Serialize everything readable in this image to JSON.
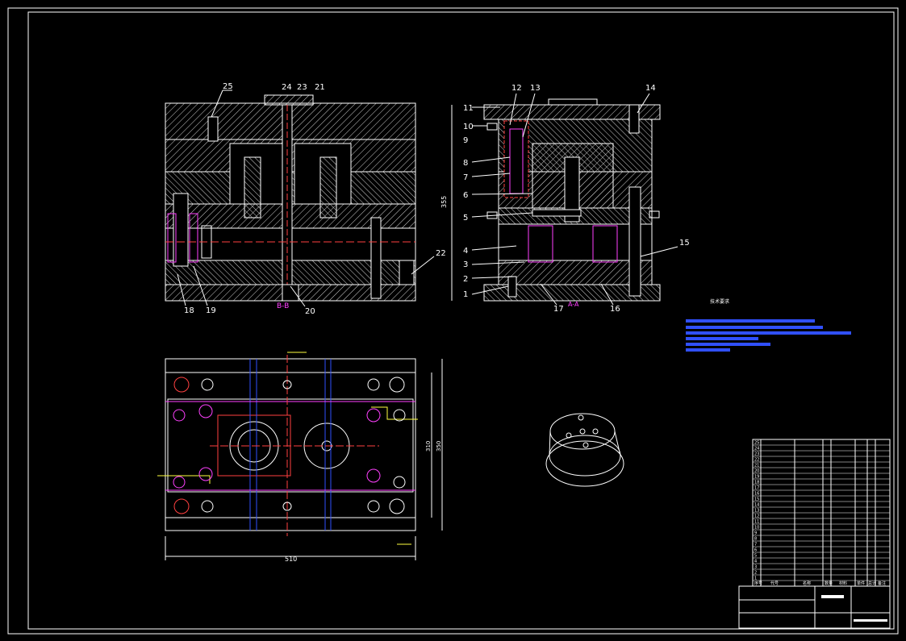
{
  "sheet": {
    "background": "#000000",
    "line_color": "#ffffff",
    "accent_red": "#ff3030",
    "accent_magenta": "#ff40ff",
    "accent_yellow": "#ffff40",
    "accent_blue": "#3050ff"
  },
  "section_left": {
    "caption": "B-B",
    "callouts": [
      "18",
      "19",
      "20",
      "21",
      "22",
      "23",
      "24",
      "25"
    ]
  },
  "section_right": {
    "caption": "A-A",
    "height_dim": "355",
    "callouts": [
      "1",
      "2",
      "3",
      "4",
      "5",
      "6",
      "7",
      "8",
      "9",
      "10",
      "11",
      "12",
      "13",
      "14",
      "15",
      "16",
      "17"
    ]
  },
  "plan_view": {
    "width_dim": "510",
    "height_dim_1": "310",
    "height_dim_2": "350"
  },
  "tech_requirements": {
    "title": "技术要求"
  },
  "parts_list": {
    "rows": [
      "25",
      "24",
      "23",
      "22",
      "21",
      "20",
      "19",
      "18",
      "17",
      "16",
      "15",
      "14",
      "13",
      "12",
      "11",
      "10",
      "9",
      "8",
      "7",
      "6",
      "5",
      "4",
      "3",
      "2",
      "1"
    ],
    "header": [
      "序号",
      "代号",
      "名称",
      "数量",
      "材料",
      "单件",
      "总计",
      "备注"
    ]
  }
}
